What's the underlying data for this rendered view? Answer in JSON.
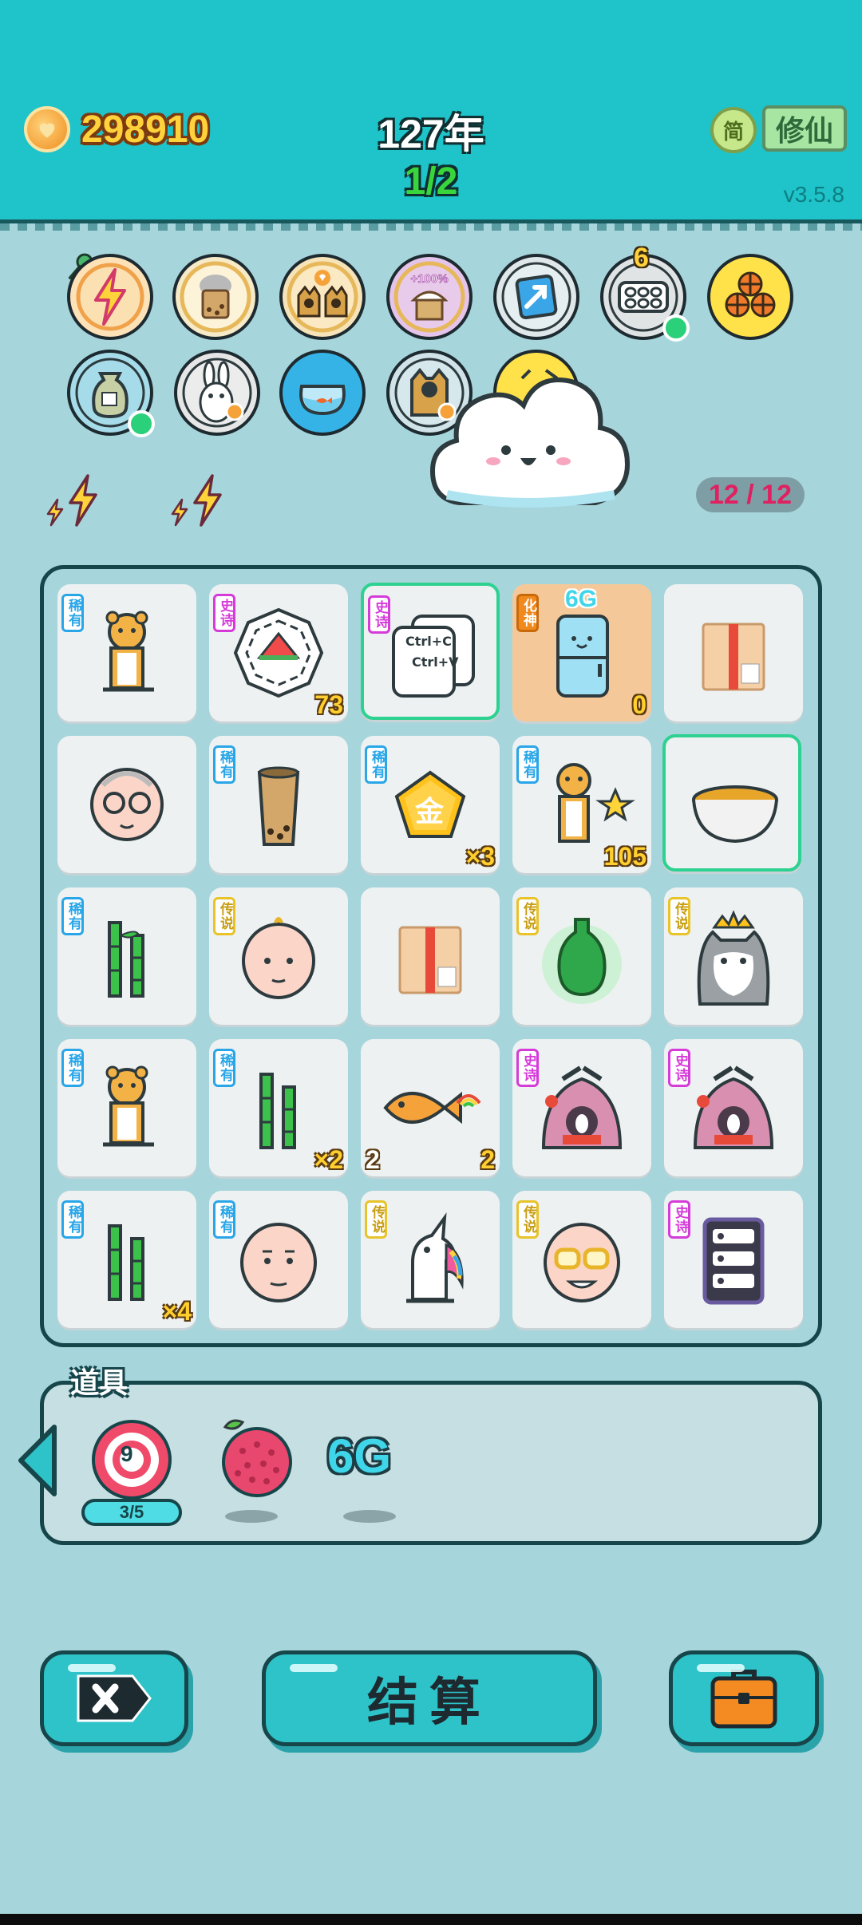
{
  "header": {
    "coins": "298910",
    "year": "127年",
    "round": "1/2",
    "lang_button": "简",
    "xiuxian_button": "修仙",
    "version": "v3.5.8"
  },
  "buffs": {
    "stack_count": "6",
    "energy_ratio": "12 / 12",
    "plus_label": "+100%"
  },
  "grid": {
    "tags": {
      "rare": "稀有",
      "epic": "史诗",
      "legend": "传说",
      "huashen": "化神"
    },
    "cells": [
      {
        "name": "tiger",
        "tag": "稀有"
      },
      {
        "name": "bagua-watermelon",
        "tag": "史诗",
        "count": "73"
      },
      {
        "name": "ctrl-cv-cards",
        "tag": "史诗",
        "text1": "Ctrl+C",
        "text2": "Ctrl+V"
      },
      {
        "name": "fridge-6g",
        "tag": "化神",
        "badge": "6G",
        "count": "0"
      },
      {
        "name": "parcel-box"
      },
      {
        "name": "old-man-glasses"
      },
      {
        "name": "milk-tea-cup",
        "tag": "稀有"
      },
      {
        "name": "gold-pentagon",
        "tag": "稀有",
        "label": "金",
        "count": "×3"
      },
      {
        "name": "tiger-with-star",
        "tag": "稀有",
        "count": "105"
      },
      {
        "name": "soup-bowl"
      },
      {
        "name": "bamboo",
        "tag": "稀有"
      },
      {
        "name": "bald-head",
        "tag": "传说"
      },
      {
        "name": "parcel-box-2"
      },
      {
        "name": "green-vase",
        "tag": "传说"
      },
      {
        "name": "husky-king",
        "tag": "传说"
      },
      {
        "name": "tiger-2",
        "tag": "稀有"
      },
      {
        "name": "bamboo-2",
        "tag": "稀有",
        "count": "×2"
      },
      {
        "name": "rainbow-fish",
        "count_left": "2",
        "count": "2"
      },
      {
        "name": "rabbit-house",
        "tag": "史诗"
      },
      {
        "name": "rabbit-house-2",
        "tag": "史诗"
      },
      {
        "name": "bamboo-3",
        "tag": "稀有",
        "count": "×4"
      },
      {
        "name": "bald-man",
        "tag": "稀有"
      },
      {
        "name": "unicorn",
        "tag": "传说"
      },
      {
        "name": "grandpa-gold-glasses",
        "tag": "传说"
      },
      {
        "name": "server-rack",
        "tag": "史诗"
      }
    ]
  },
  "props": {
    "title": "道具",
    "target_number": "9",
    "target_progress": "3/5",
    "g6_label": "6G"
  },
  "buttons": {
    "settle": "结算"
  },
  "colors": {
    "header_bg": "#1ec4c9",
    "page_bg": "#a6d5db",
    "accent_teal": "#2dc3c9",
    "coin_gold": "#ffd23c",
    "round_green": "#38d63c",
    "rare_blue": "#29a6e8",
    "epic_purple": "#d53bd9",
    "legend_yellow": "#e8c32a"
  }
}
